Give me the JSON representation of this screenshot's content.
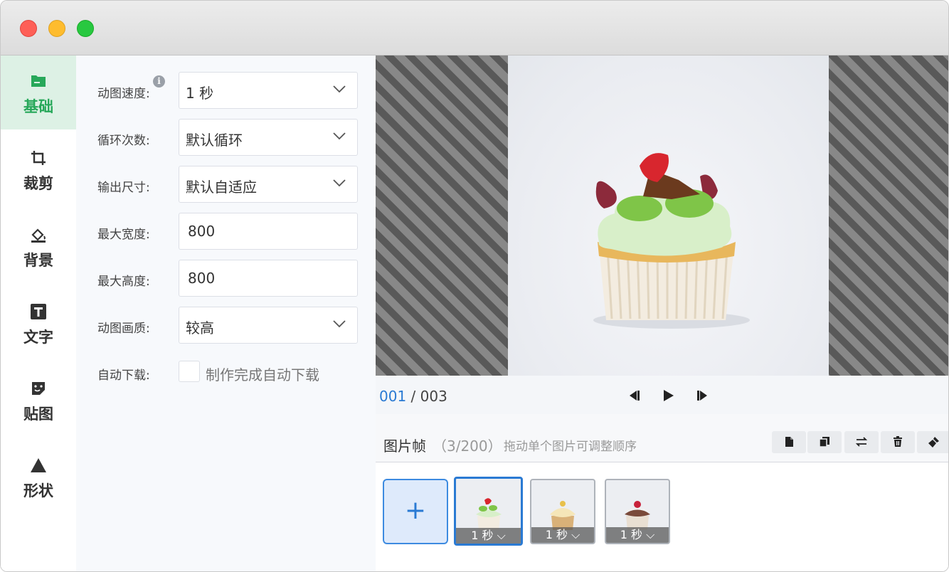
{
  "sidebar": {
    "items": [
      {
        "label": "基础",
        "icon": "folder-icon",
        "active": true
      },
      {
        "label": "裁剪",
        "icon": "crop-icon",
        "active": false
      },
      {
        "label": "背景",
        "icon": "paint-bucket-icon",
        "active": false
      },
      {
        "label": "文字",
        "icon": "text-icon",
        "active": false
      },
      {
        "label": "贴图",
        "icon": "sticker-icon",
        "active": false
      },
      {
        "label": "形状",
        "icon": "triangle-icon",
        "active": false
      }
    ]
  },
  "settings": {
    "speed": {
      "label": "动图速度:",
      "value": "1 秒"
    },
    "loop": {
      "label": "循环次数:",
      "value": "默认循环"
    },
    "size": {
      "label": "输出尺寸:",
      "value": "默认自适应"
    },
    "max_width": {
      "label": "最大宽度:",
      "value": "800"
    },
    "max_height": {
      "label": "最大高度:",
      "value": "800"
    },
    "quality": {
      "label": "动图画质:",
      "value": "较高"
    },
    "auto_download": {
      "label": "自动下载:",
      "checkbox_label": "制作完成自动下载",
      "checked": false
    }
  },
  "playback": {
    "current": "001",
    "separator": " / ",
    "total": "003"
  },
  "frames": {
    "title": "图片帧",
    "count": "（3/200）",
    "hint": "拖动单个图片可调整顺序",
    "add_label": "+",
    "items": [
      {
        "speed": "1 秒",
        "selected": true
      },
      {
        "speed": "1 秒",
        "selected": false
      },
      {
        "speed": "1 秒",
        "selected": false
      }
    ]
  },
  "colors": {
    "accent_green": "#27a85a",
    "accent_blue": "#2a7ad3"
  }
}
